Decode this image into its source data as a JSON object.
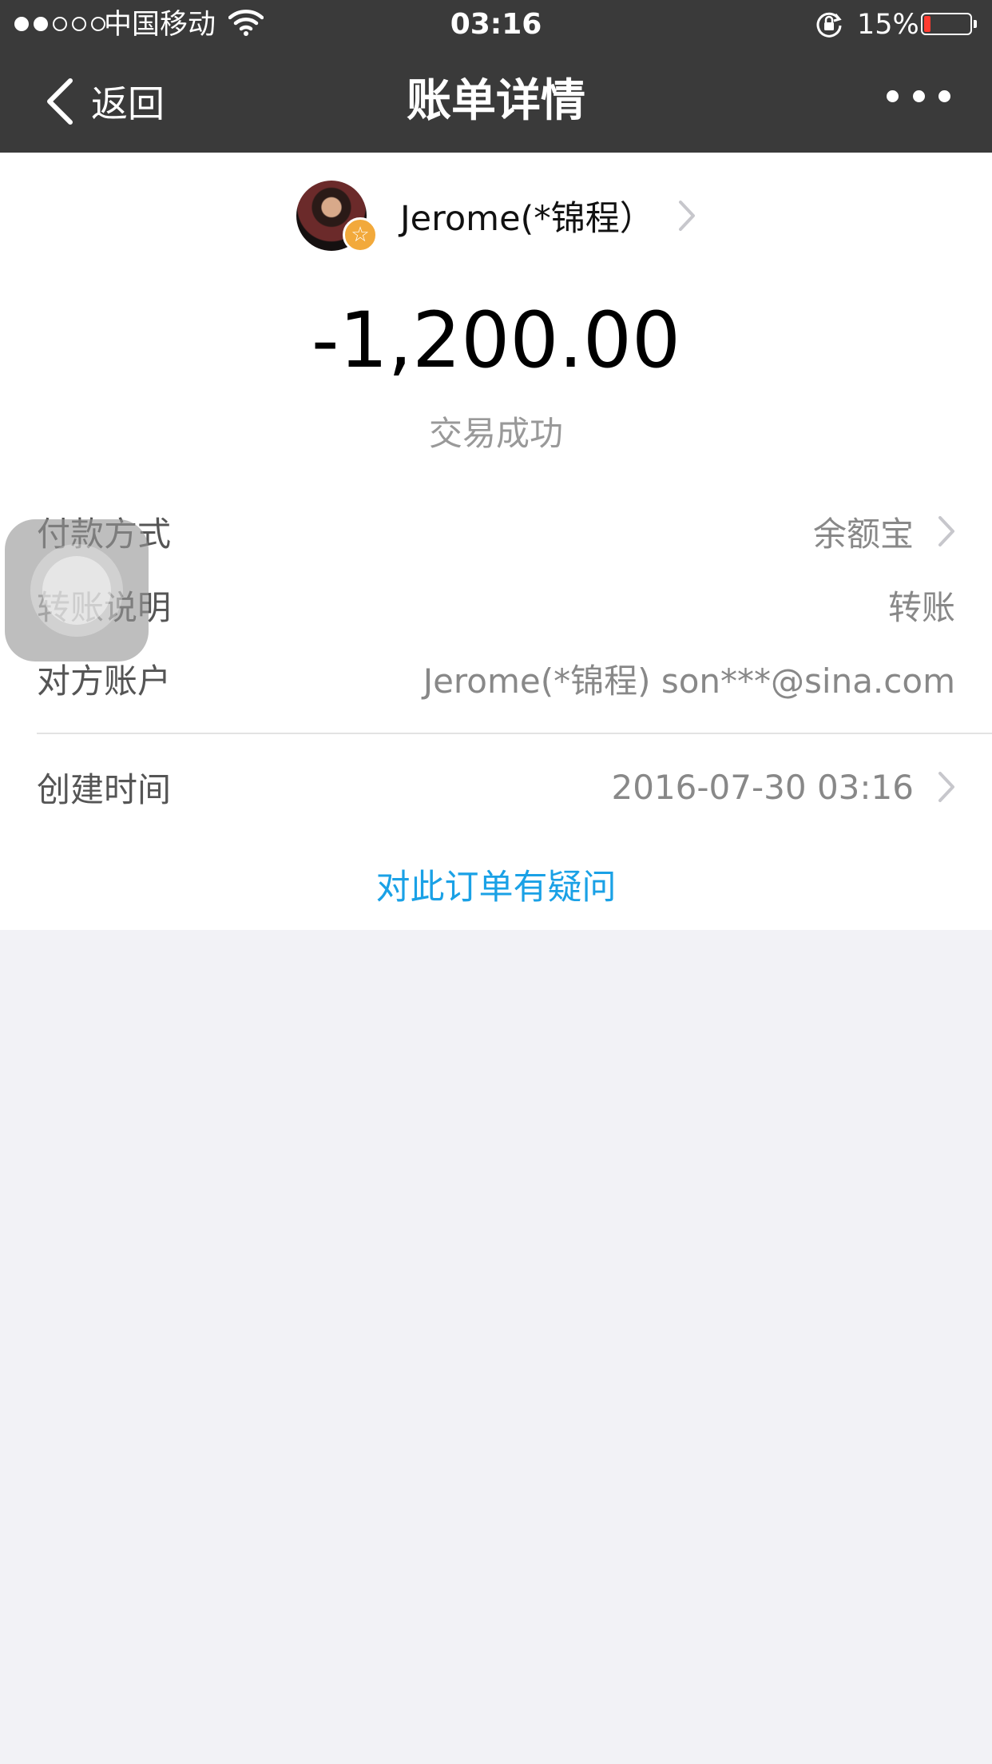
{
  "status_bar": {
    "carrier": "中国移动",
    "time": "03:16",
    "battery_percent": "15%",
    "battery_level": 0.15,
    "signal_strength": 2,
    "signal_total": 5
  },
  "nav": {
    "back_label": "返回",
    "title": "账单详情"
  },
  "payee": {
    "name": "Jerome(*锦程）"
  },
  "transaction": {
    "amount": "-1,200.00",
    "status": "交易成功"
  },
  "details": {
    "payment_method_label": "付款方式",
    "payment_method_value": "余额宝",
    "note_label": "转账说明",
    "note_value": "转账",
    "account_label": "对方账户",
    "account_value": "Jerome(*锦程) son***@sina.com",
    "created_label": "创建时间",
    "created_value": "2016-07-30 03:16"
  },
  "question_link": "对此订单有疑问",
  "colors": {
    "nav_bar": "#3a3a3a",
    "link": "#1aa1e6",
    "page_background": "#f2f2f6",
    "badge": "#f2a93b",
    "battery_low": "#ff3b30"
  },
  "icons": [
    "wifi-icon",
    "rotation-lock-icon",
    "battery-icon",
    "back-chevron-icon",
    "more-icon",
    "star-badge-icon",
    "chevron-right-icon",
    "assistive-touch-icon"
  ]
}
